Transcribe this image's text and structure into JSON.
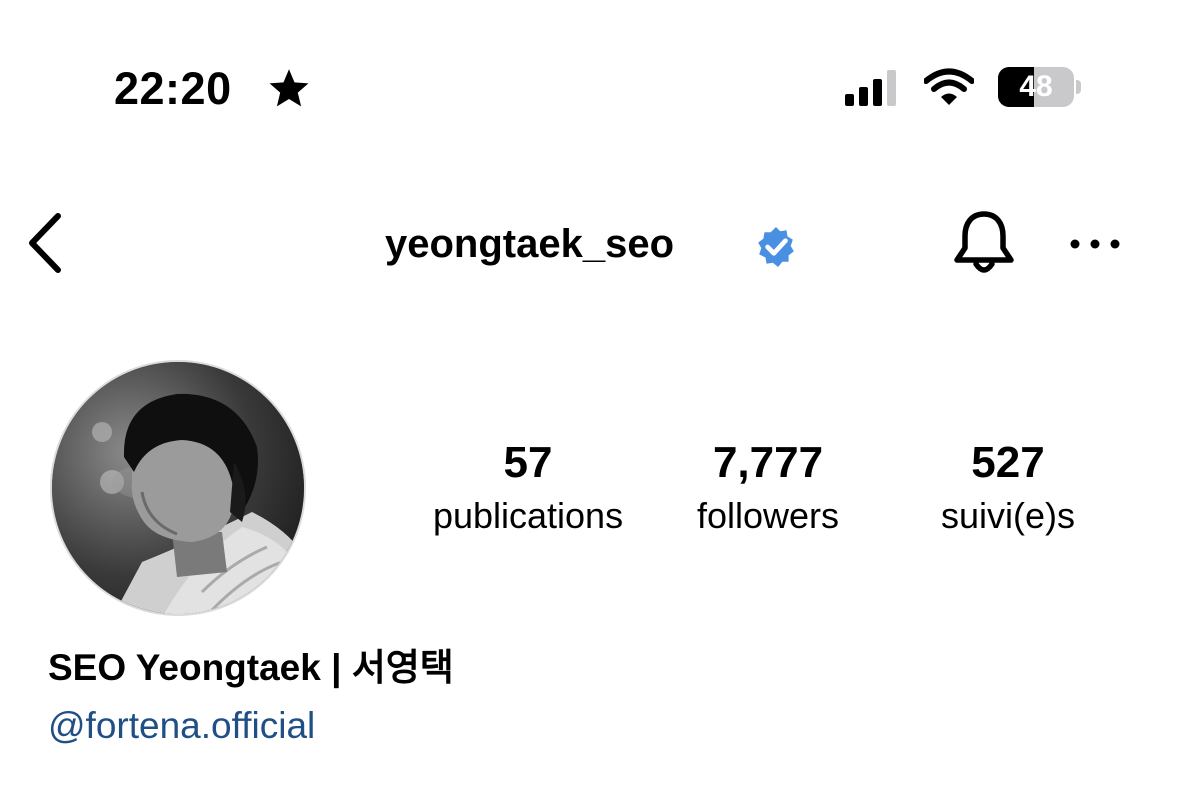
{
  "status_bar": {
    "time": "22:20",
    "focus_icon": "star-icon",
    "signal_icon": "cellular-signal-icon",
    "wifi_icon": "wifi-icon",
    "battery_level": "48",
    "battery_fraction": 0.48
  },
  "nav": {
    "back_icon": "chevron-left-icon",
    "username": "yeongtaek_seo",
    "verified_icon": "verified-badge-icon",
    "verified_color": "#4a90e2",
    "bell_icon": "bell-icon",
    "more_icon": "more-horizontal-icon"
  },
  "profile": {
    "avatar_icon": "profile-photo",
    "stats": [
      {
        "value": "57",
        "label": "publications"
      },
      {
        "value": "7,777",
        "label": "followers"
      },
      {
        "value": "527",
        "label": "suivi(e)s"
      }
    ],
    "display_name": "SEO Yeongtaek | 서영택",
    "mention": "@fortena.official",
    "mention_color": "#1f4f85"
  }
}
